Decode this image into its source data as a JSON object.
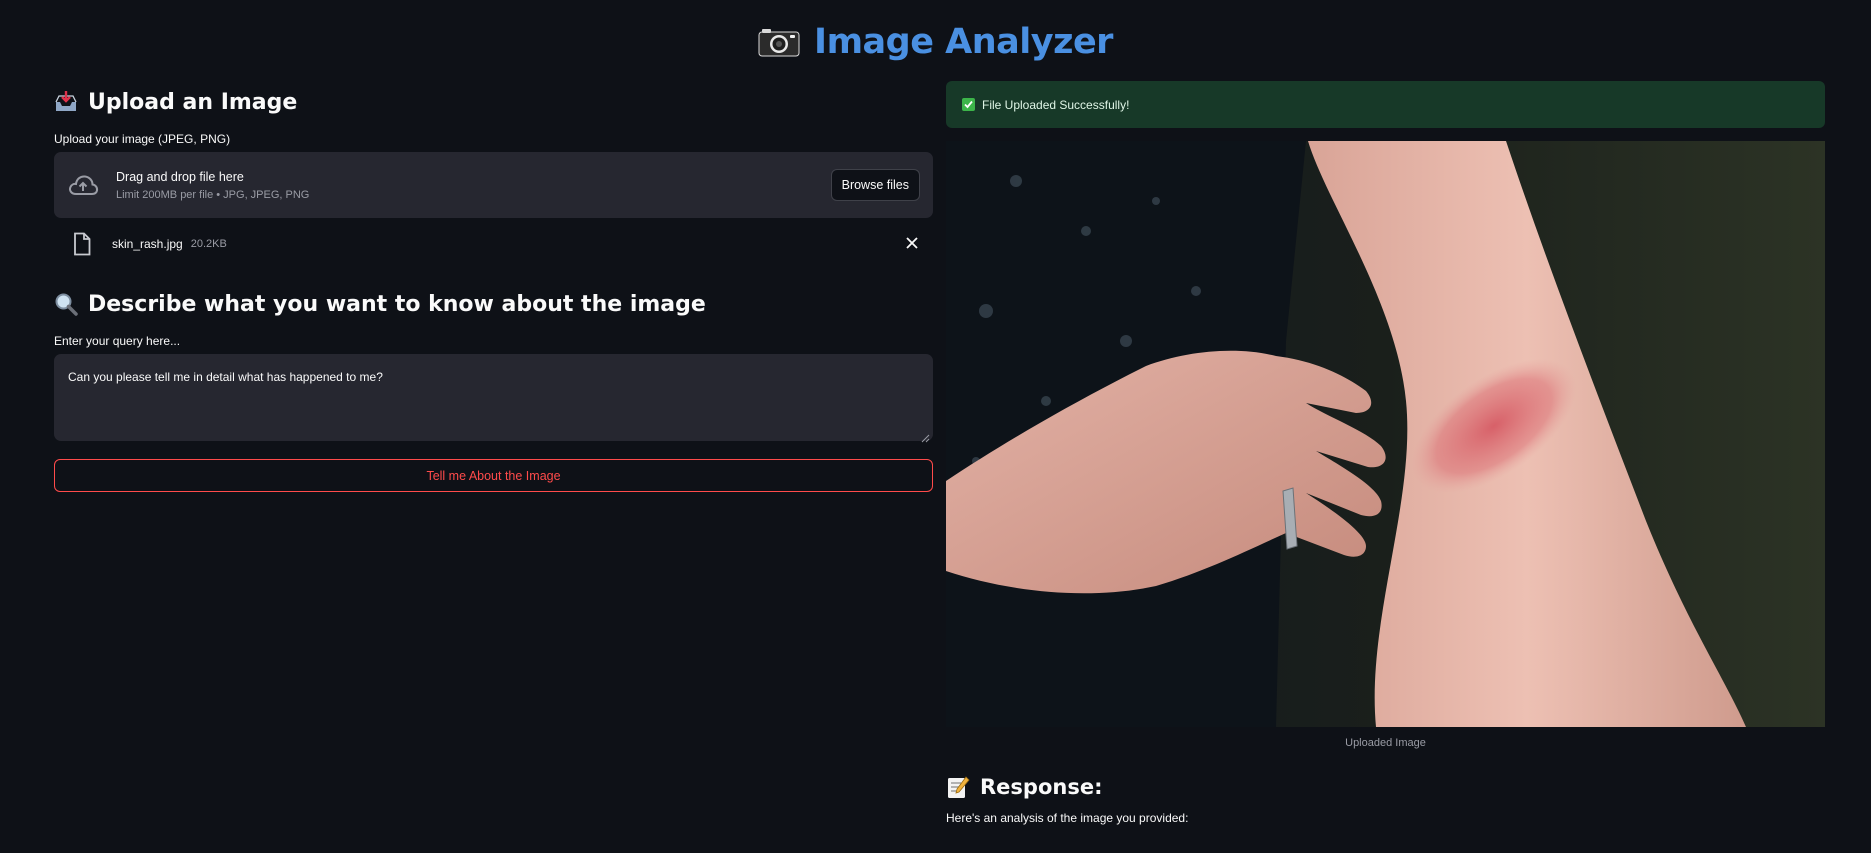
{
  "header": {
    "title": "Image Analyzer",
    "emoji": "camera-icon"
  },
  "upload": {
    "heading": "Upload an Image",
    "heading_icon": "inbox-tray-icon",
    "label": "Upload your image (JPEG, PNG)",
    "drop_main": "Drag and drop file here",
    "drop_sub": "Limit 200MB per file • JPG, JPEG, PNG",
    "browse_label": "Browse files",
    "file": {
      "name": "skin_rash.jpg",
      "size": "20.2KB"
    }
  },
  "query": {
    "heading": "Describe what you want to know about the image",
    "heading_icon": "magnifier-icon",
    "label": "Enter your query here...",
    "value": "Can you please tell me in detail what has happened to me?"
  },
  "actions": {
    "analyze_label": "Tell me About the Image"
  },
  "status": {
    "message": "File Uploaded Successfully!"
  },
  "preview": {
    "caption": "Uploaded Image",
    "subject": "photo-forearm-rash"
  },
  "response": {
    "heading": "Response:",
    "heading_icon": "memo-icon",
    "intro": "Here's an analysis of the image you provided:"
  },
  "colors": {
    "background": "#0e1117",
    "title": "#4a90e2",
    "accent": "#ff4b4b",
    "success_bg": "#173928",
    "input_bg": "#262730"
  }
}
